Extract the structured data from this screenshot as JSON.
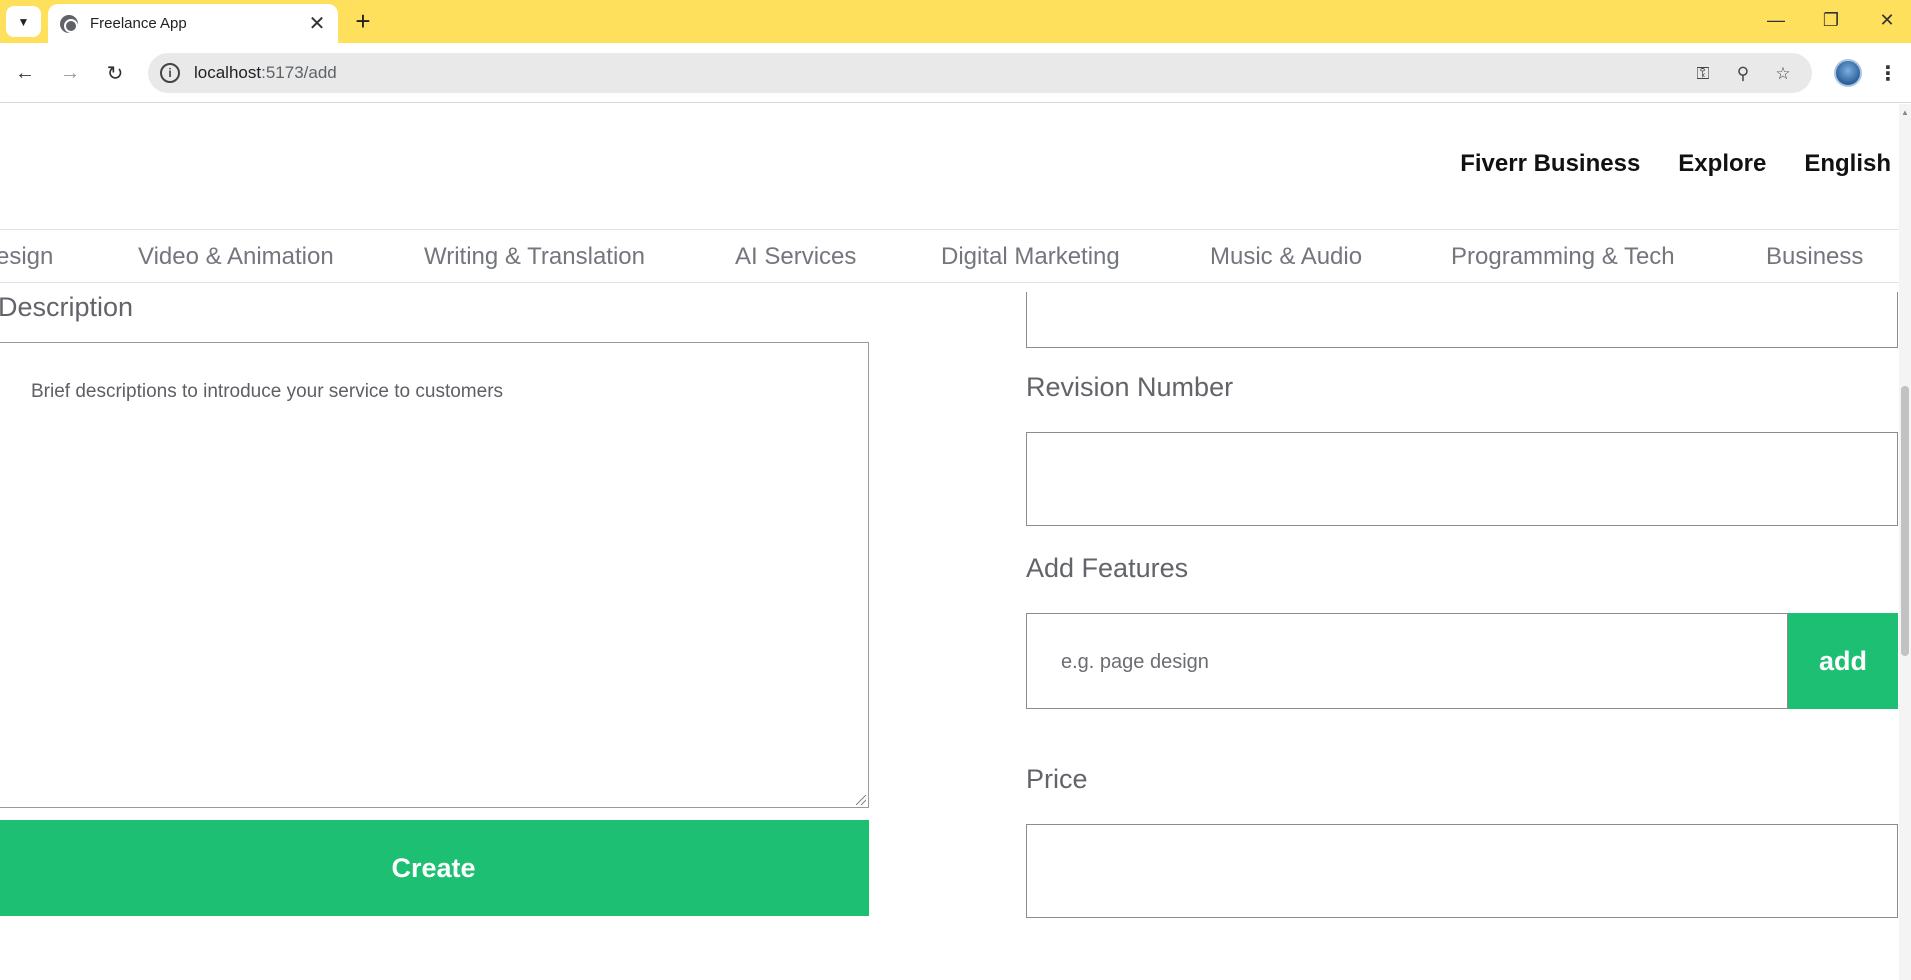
{
  "browser": {
    "tab_title": "Freelance App",
    "url_host": "localhost",
    "url_path": ":5173/add",
    "icons": {
      "tab_search": "chevron-down-icon",
      "favicon": "globe-icon",
      "tab_close": "close-icon",
      "new_tab": "plus-icon",
      "minimize": "minimize-icon",
      "restore": "restore-icon",
      "close_window": "close-icon",
      "back": "arrow-left-icon",
      "forward": "arrow-right-icon",
      "reload": "reload-icon",
      "site_info": "info-icon",
      "passwords": "key-icon",
      "zoom": "zoom-icon",
      "bookmark": "star-icon",
      "menu": "more-vertical-icon"
    }
  },
  "header": {
    "links": [
      "Fiverr Business",
      "Explore",
      "English"
    ]
  },
  "categories": [
    "esign",
    "Video & Animation",
    "Writing & Translation",
    "AI Services",
    "Digital Marketing",
    "Music & Audio",
    "Programming & Tech",
    "Business"
  ],
  "form": {
    "description_label": "Description",
    "description_placeholder": "Brief descriptions to introduce your service to customers",
    "create_label": "Create",
    "revision_label": "Revision Number",
    "features_label": "Add Features",
    "features_placeholder": "e.g. page design",
    "add_label": "add",
    "price_label": "Price"
  },
  "colors": {
    "brand_green": "#1dbf73",
    "tabbar": "#ffe05c"
  }
}
